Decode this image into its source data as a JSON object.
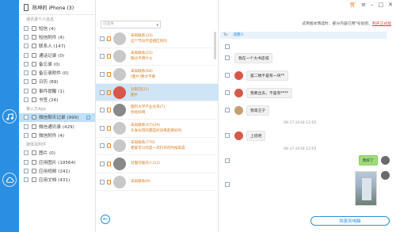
{
  "device": {
    "name": "陈坤的 iPhone (3)"
  },
  "topbar": {
    "cart_icon": "cart-icon",
    "icons": [
      "≡",
      "–",
      "□",
      "✕"
    ]
  },
  "sections": [
    {
      "title": "通讯录个人信息"
    },
    {
      "title": "第三方App"
    },
    {
      "title": "媒体及附件"
    }
  ],
  "categories": [
    {
      "label": "短信 (4)"
    },
    {
      "label": "短信附件 (4)"
    },
    {
      "label": "联系人 (147)"
    },
    {
      "label": "通话记录 (0)"
    },
    {
      "label": "备忘录 (0)"
    },
    {
      "label": "备忘录附件 (0)"
    },
    {
      "label": "日历 (89)"
    },
    {
      "label": "事件提醒 (1)"
    },
    {
      "label": "书签 (26)"
    },
    {
      "label": "微信聊天记录 (999)"
    },
    {
      "label": "微信通讯录 (429)"
    },
    {
      "label": "微信附件 (4)"
    },
    {
      "label": "图片 (0)"
    },
    {
      "label": "应用图片 (19564)"
    },
    {
      "label": "应用视频 (241)"
    },
    {
      "label": "应用文档 (431)"
    }
  ],
  "search": {
    "placeholder": "已选择"
  },
  "messages": [
    {
      "t1": "未知联系(33)",
      "t2": "这个节日不是相应的吗"
    },
    {
      "t1": "未知联系(25)",
      "t2": "我也不用什么"
    },
    {
      "t1": "未知联系(68)",
      "t2": "[图片]我才不要"
    },
    {
      "t1": "对影回(21)",
      "t2": "图片"
    },
    {
      "t1": "国内大学产业化讯(7)",
      "t2": "你啥好啊"
    },
    {
      "t1": "未知联系(47)(29)",
      "t2": "头发长得的都是好没看起来好吗"
    },
    {
      "t1": "未知联系(770)",
      "t2": "相爱可以的是一次打开的时候就是"
    },
    {
      "t1": "对面可能的人(12)",
      "t2": ""
    },
    {
      "t1": "未知联系(9)",
      "t2": ""
    }
  ],
  "hint": {
    "text": "试用版本预选时，部分内容已用*号加密。",
    "link": "购买正式版"
  },
  "conversation": {
    "to_label": "To:",
    "to_name": "成都人",
    "bubbles": [
      "我在一个大书店城",
      "是二楼不是有一块**",
      "我要出去，不是有****",
      "我等王宁",
      "上班吧"
    ],
    "timestamps": [
      "08-17-2018 12:05",
      "08-17-2018 12:05"
    ],
    "right_bubble": "我好了"
  },
  "restore_button": {
    "label": "恢复到电脑"
  },
  "colors": {
    "accent": "#2a8fe0",
    "warn": "#d47d1d",
    "active": "#bfe0f7"
  }
}
